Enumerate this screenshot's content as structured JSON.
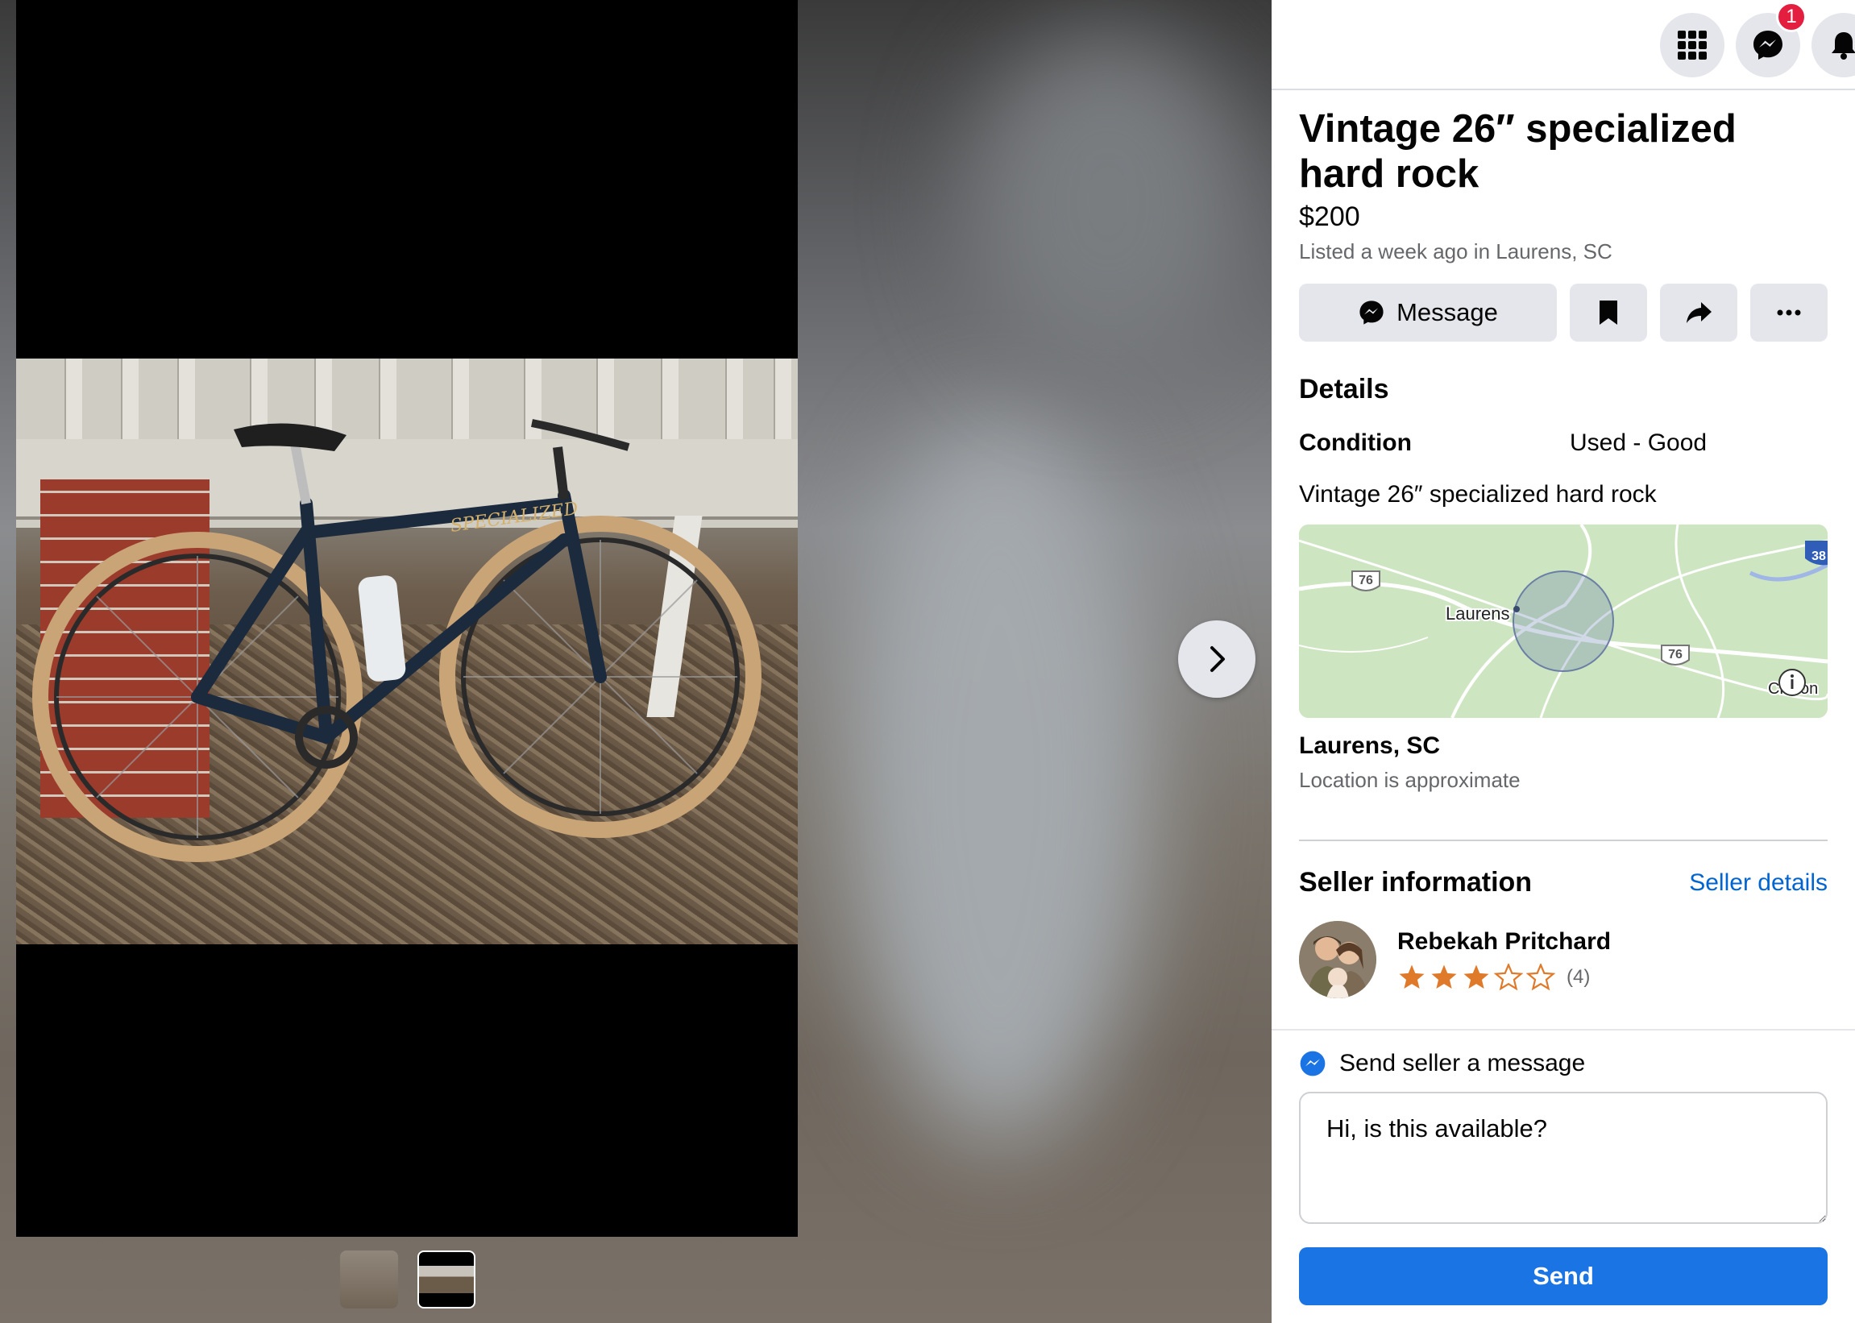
{
  "listing": {
    "title": "Vintage 26″ specialized hard rock",
    "price": "$200",
    "listed": "Listed a week ago in Laurens, SC"
  },
  "actions": {
    "message_label": "Message"
  },
  "topbar": {
    "messenger_badge": "1"
  },
  "details": {
    "heading": "Details",
    "condition_label": "Condition",
    "condition_value": "Used - Good",
    "description": "Vintage 26″ specialized hard rock"
  },
  "map": {
    "city_label": "Laurens",
    "route_label": "76",
    "interstate_label": "38",
    "nearby_town_label": "Clinton"
  },
  "location": {
    "name": "Laurens, SC",
    "note": "Location is approximate"
  },
  "seller": {
    "heading": "Seller information",
    "details_link": "Seller details",
    "name": "Rebekah Pritchard",
    "rating": 3,
    "rating_max": 5,
    "rating_count": "(4)"
  },
  "send": {
    "heading": "Send seller a message",
    "message_value": "Hi, is this available?",
    "button_label": "Send"
  },
  "colors": {
    "primary": "#1b74e4",
    "link": "#0064d1",
    "star": "#e07a2b",
    "badge": "#e41e3f"
  }
}
